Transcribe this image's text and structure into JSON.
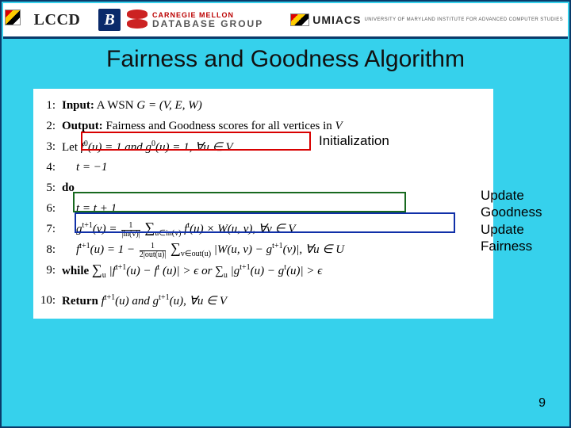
{
  "header": {
    "lccd": "LCCD",
    "b": "B",
    "cmu_l1": "CARNEGIE MELLON",
    "cmu_l2": "DATABASE GROUP",
    "umiacs": "UMIACS",
    "umiacs_sub": "UNIVERSITY OF MARYLAND INSTITUTE FOR ADVANCED COMPUTER STUDIES"
  },
  "title": "Fairness and Goodness Algorithm",
  "algo": {
    "n1": "1:",
    "l1a": "Input:",
    "l1b": " A WSN ",
    "l1c": "G = (V, E, W)",
    "n2": "2:",
    "l2a": "Output:",
    "l2b": " Fairness and Goodness scores for all vertices in ",
    "l2c": "V",
    "n3": "3:",
    "l3a": "Let ",
    "l3b": "f",
    "l3c": "0",
    "l3d": "(u) = 1 and g",
    "l3e": "0",
    "l3f": "(u) = 1, ∀u ∈ V",
    "n4": "4:",
    "l4": "t = −1",
    "n5": "5:",
    "l5": "do",
    "n6": "6:",
    "l6": "t = t + 1",
    "n7": "7:",
    "l7a": "g",
    "l7b": "t+1",
    "l7c": "(v) = ",
    "l7d": "1",
    "l7e": "|in(v)|",
    "l7f": " ∑",
    "l7g": "u∈in(v)",
    "l7h": " f",
    "l7i": "t",
    "l7j": "(u) × W(u, v), ∀v ∈ V",
    "n8": "8:",
    "l8a": "f",
    "l8b": "t+1",
    "l8c": "(u) = 1 − ",
    "l8d": "1",
    "l8e": "2|out(u)|",
    "l8f": " ∑",
    "l8g": "v∈out(u)",
    "l8h": " |W(u, v) − g",
    "l8i": "t+1",
    "l8j": "(v)|, ∀u ∈ U",
    "n9": "9:",
    "l9a": "while ",
    "l9b": "∑",
    "l9c": "u",
    "l9d": " |f",
    "l9e": "t+1",
    "l9f": "(u) − f",
    "l9g": "t",
    "l9h": "(u)| > ϵ  or  ∑",
    "l9i": "u",
    "l9j": " |g",
    "l9k": "t+1",
    "l9l": "(u) − g",
    "l9m": "t",
    "l9n": "(u)| > ϵ",
    "n10": "10:",
    "l10a": "Return ",
    "l10b": "f",
    "l10c": "t+1",
    "l10d": "(u) and g",
    "l10e": "t+1",
    "l10f": "(u), ∀u ∈ V"
  },
  "annot": {
    "init": "Initialization",
    "upd1": "Update Goodness",
    "upd2": "Update Fairness"
  },
  "page": "9"
}
